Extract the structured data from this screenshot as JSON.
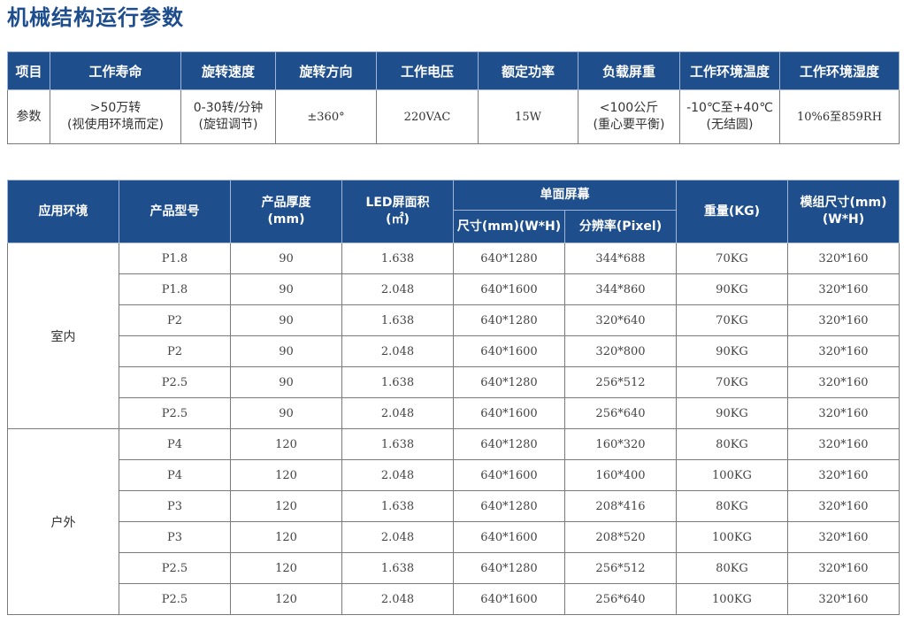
{
  "page_title": "机械结构运行参数",
  "params_table": {
    "headers": [
      "项目",
      "工作寿命",
      "旋转速度",
      "旋转方向",
      "工作电压",
      "额定功率",
      "负载屏重",
      "工作环境温度",
      "工作环境湿度"
    ],
    "row": {
      "label": "参数",
      "lifetime": [
        ">50万转",
        "(视使用环境而定)"
      ],
      "speed": [
        "0-30转/分钟",
        "(旋钮调节)"
      ],
      "direction": "±360°",
      "voltage": "220VAC",
      "power": "15W",
      "load": [
        "<100公斤",
        "(重心要平衡)"
      ],
      "temperature": [
        "-10℃至+40℃",
        "(无结圆)"
      ],
      "humidity": "10%6至859RH"
    }
  },
  "spec_table": {
    "headers": {
      "env": "应用环境",
      "model": "产品型号",
      "thickness": [
        "产品厚度",
        "(mm)"
      ],
      "led_area": [
        "LED屏面积",
        "(㎡)"
      ],
      "single_screen": "单面屏幕",
      "size": "尺寸(mm)(W*H)",
      "resolution": "分辨率(Pixel)",
      "weight": "重量(KG)",
      "module_size": [
        "模组尺寸(mm)",
        "(W*H)"
      ]
    },
    "groups": [
      {
        "env": "室内",
        "rows": [
          {
            "model": "P1.8",
            "thickness": "90",
            "area": "1.638",
            "size": "640*1280",
            "resolution": "344*688",
            "weight": "70KG",
            "module": "320*160"
          },
          {
            "model": "P1.8",
            "thickness": "90",
            "area": "2.048",
            "size": "640*1600",
            "resolution": "344*860",
            "weight": "90KG",
            "module": "320*160"
          },
          {
            "model": "P2",
            "thickness": "90",
            "area": "1.638",
            "size": "640*1280",
            "resolution": "320*640",
            "weight": "70KG",
            "module": "320*160"
          },
          {
            "model": "P2",
            "thickness": "90",
            "area": "2.048",
            "size": "640*1600",
            "resolution": "320*800",
            "weight": "90KG",
            "module": "320*160"
          },
          {
            "model": "P2.5",
            "thickness": "90",
            "area": "1.638",
            "size": "640*1280",
            "resolution": "256*512",
            "weight": "70KG",
            "module": "320*160"
          },
          {
            "model": "P2.5",
            "thickness": "90",
            "area": "2.048",
            "size": "640*1600",
            "resolution": "256*640",
            "weight": "90KG",
            "module": "320*160"
          }
        ]
      },
      {
        "env": "户外",
        "rows": [
          {
            "model": "P4",
            "thickness": "120",
            "area": "1.638",
            "size": "640*1280",
            "resolution": "160*320",
            "weight": "80KG",
            "module": "320*160"
          },
          {
            "model": "P4",
            "thickness": "120",
            "area": "2.048",
            "size": "640*1600",
            "resolution": "160*400",
            "weight": "100KG",
            "module": "320*160"
          },
          {
            "model": "P3",
            "thickness": "120",
            "area": "1.638",
            "size": "640*1280",
            "resolution": "208*416",
            "weight": "80KG",
            "module": "320*160"
          },
          {
            "model": "P3",
            "thickness": "120",
            "area": "2.048",
            "size": "640*1600",
            "resolution": "208*520",
            "weight": "100KG",
            "module": "320*160"
          },
          {
            "model": "P2.5",
            "thickness": "120",
            "area": "1.638",
            "size": "640*1280",
            "resolution": "256*512",
            "weight": "80KG",
            "module": "320*160"
          },
          {
            "model": "P2.5",
            "thickness": "120",
            "area": "2.048",
            "size": "640*1600",
            "resolution": "256*640",
            "weight": "100KG",
            "module": "320*160"
          }
        ]
      }
    ]
  }
}
